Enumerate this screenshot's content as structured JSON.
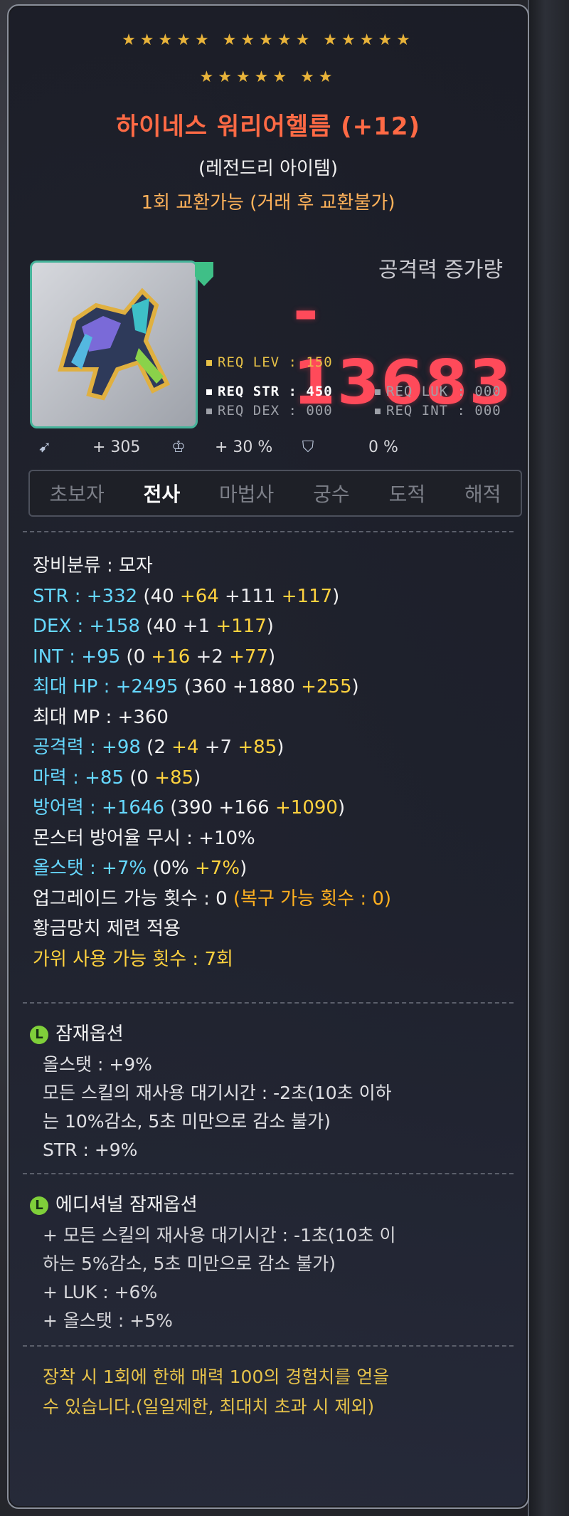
{
  "item": {
    "stars_row1": "★★★★★ ★★★★★ ★★★★★",
    "stars_row2": "★★★★★ ★★",
    "name": "하이네스 워리어헬름 (+12)",
    "grade": "(레전드리 아이템)",
    "trade_note": "1회 교환가능 (거래 후 교환불가)",
    "image_icon": "helmet-icon"
  },
  "attack_increase": {
    "label": "공격력 증가량",
    "value": "- 13683"
  },
  "requirements": {
    "lev": "REQ LEV : 150",
    "str": "REQ STR : 450",
    "luk": "REQ LUK : 000",
    "dex": "REQ DEX : 000",
    "int": "REQ INT : 000"
  },
  "mini_stats": {
    "first": "+ 305",
    "second": "+ 30 %",
    "third": "0 %"
  },
  "classes": [
    "초보자",
    "전사",
    "마법사",
    "궁수",
    "도적",
    "해적"
  ],
  "active_class": "전사",
  "stats": {
    "category": "장비분류 : 모자",
    "str_label": "STR : +332",
    "str_base": " (40 ",
    "str_add1": "+64",
    "str_add2": " +111",
    "str_add3": " +117",
    "str_end": ")",
    "dex_label": "DEX : +158",
    "dex_base": " (40 ",
    "dex_add1": "+1",
    "dex_add2": " +117",
    "dex_end": ")",
    "int_label": "INT : +95",
    "int_base": " (0 ",
    "int_add1": "+16",
    "int_add2": " +2",
    "int_add3": " +77",
    "int_end": ")",
    "hp_label": "최대 HP : +2495",
    "hp_base": " (360 +1880 ",
    "hp_add": "+255",
    "hp_end": ")",
    "mp": "최대 MP : +360",
    "atk_label": "공격력 : +98",
    "atk_base": " (2 ",
    "atk_add1": "+4",
    "atk_add2": " +7",
    "atk_add3": " +85",
    "atk_end": ")",
    "mag_label": "마력 : +85",
    "mag_base": " (0 ",
    "mag_add": "+85",
    "mag_end": ")",
    "def_label": "방어력 : +1646",
    "def_base": " (390 +166 ",
    "def_add": "+1090",
    "def_end": ")",
    "ignore_def": "몬스터 방어율 무시 : +10%",
    "allstat_label": "올스탯 : +7%",
    "allstat_base": " (0% ",
    "allstat_add": "+7%",
    "allstat_end": ")",
    "upgrade": "업그레이드 가능 횟수 : 0",
    "upgrade_restore": " (복구 가능 횟수 : 0)",
    "golden_hammer": "황금망치 제련 적용",
    "scissors": "가위 사용 가능 횟수 : 7회"
  },
  "potential": {
    "badge": "L",
    "title": "잠재옵션",
    "lines": [
      "올스탯 : +9%",
      "모든 스킬의 재사용 대기시간 : -2초(10초 이하",
      "는 10%감소, 5초 미만으로 감소 불가)",
      "STR : +9%"
    ]
  },
  "additional_potential": {
    "badge": "L",
    "title": "에디셔널 잠재옵션",
    "lines": [
      "+ 모든 스킬의 재사용 대기시간 : -1초(10초 이",
      "하는 5%감소, 5초 미만으로 감소 불가)",
      "+ LUK : +6%",
      "+ 올스탯 : +5%"
    ]
  },
  "footer": {
    "line1": "장착 시 1회에 한해 매력 100의 경험치를 얻을",
    "line2": "수 있습니다.(일일제한, 최대치 초과 시 제외)"
  },
  "colors": {
    "title": "#ff6a45",
    "attack_value": "#ff4a5a",
    "stat_cyan": "#66d8ff",
    "stat_yellow": "#ffd23f",
    "potential_badge": "#7fcf3a",
    "footer": "#e6c24a"
  }
}
